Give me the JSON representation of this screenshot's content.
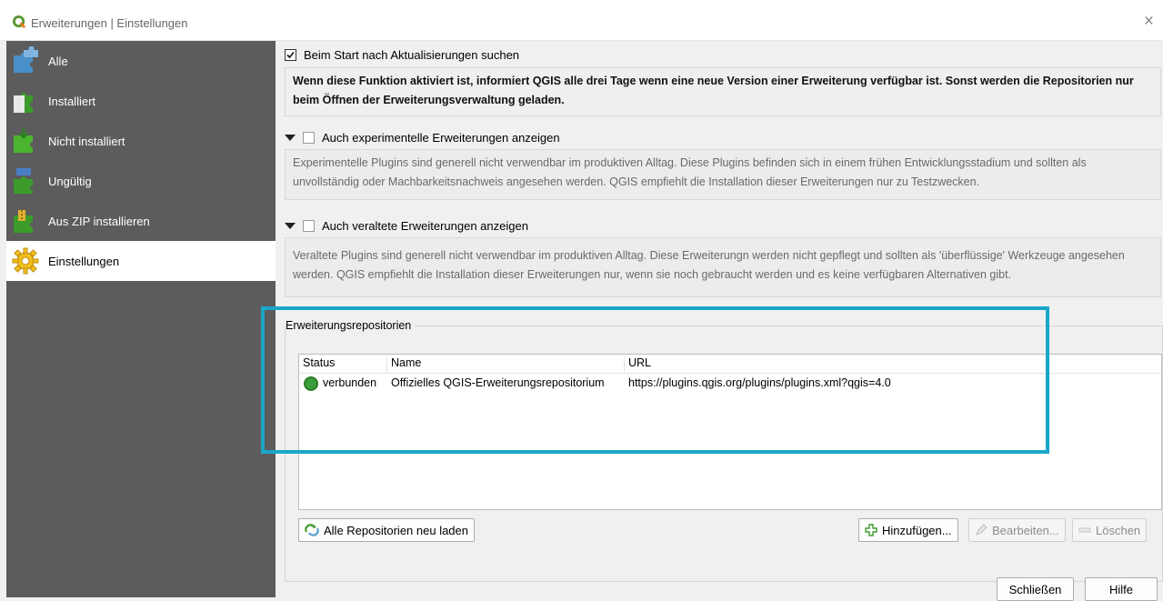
{
  "window": {
    "title": "Erweiterungen | Einstellungen",
    "close_glyph": "×"
  },
  "sidebar": {
    "items": [
      {
        "label": "Alle",
        "icon": "puzzle-all-icon"
      },
      {
        "label": "Installiert",
        "icon": "puzzle-installed-icon"
      },
      {
        "label": "Nicht installiert",
        "icon": "puzzle-not-installed-icon"
      },
      {
        "label": "Ungültig",
        "icon": "puzzle-invalid-icon"
      },
      {
        "label": "Aus ZIP installieren",
        "icon": "zip-install-icon"
      },
      {
        "label": "Einstellungen",
        "icon": "settings-gear-icon",
        "selected": true
      }
    ]
  },
  "settings": {
    "check_updates_label": "Beim Start nach Aktualisierungen suchen",
    "check_updates_checked": true,
    "check_updates_info": "Wenn diese Funktion aktiviert ist, informiert QGIS alle drei Tage wenn eine neue Version einer Erweiterung verfügbar ist. Sonst werden die Repositorien nur beim Öffnen der Erweiterungsverwaltung geladen.",
    "experimental_label": "Auch experimentelle Erweiterungen anzeigen",
    "experimental_checked": false,
    "experimental_info": "Experimentelle Plugins sind generell nicht verwendbar im produktiven Alltag. Diese Plugins befinden sich in einem frühen Entwicklungsstadium und sollten als unvollständig oder Machbarkeitsnachweis angesehen werden. QGIS empfiehlt die Installation dieser Erweiterungen nur zu Testzwecken.",
    "deprecated_label": "Auch veraltete Erweiterungen anzeigen",
    "deprecated_checked": false,
    "deprecated_info": "Veraltete Plugins sind generell nicht verwendbar im produktiven Alltag. Diese Erweiterungn werden nicht gepflegt und sollten als 'überflüssige' Werkzeuge angesehen werden. QGIS empfiehlt die Installation dieser Erweiterungen nur, wenn sie noch gebraucht werden und es keine verfügbaren Alternativen gibt."
  },
  "repositories": {
    "group_title": "Erweiterungsrepositorien",
    "columns": [
      "Status",
      "Name",
      "URL"
    ],
    "rows": [
      {
        "status": "verbunden",
        "name": "Offizielles QGIS-Erweiterungsrepositorium",
        "url": "https://plugins.qgis.org/plugins/plugins.xml?qgis=4.0"
      }
    ],
    "reload_button": "Alle Repositorien neu laden",
    "add_button": "Hinzufügen...",
    "edit_button": "Bearbeiten...",
    "delete_button": "Löschen"
  },
  "footer": {
    "close_button": "Schließen",
    "help_button": "Hilfe"
  },
  "colors": {
    "highlight": "#1aa6c9",
    "sidebar_bg": "#5c5c5c"
  }
}
